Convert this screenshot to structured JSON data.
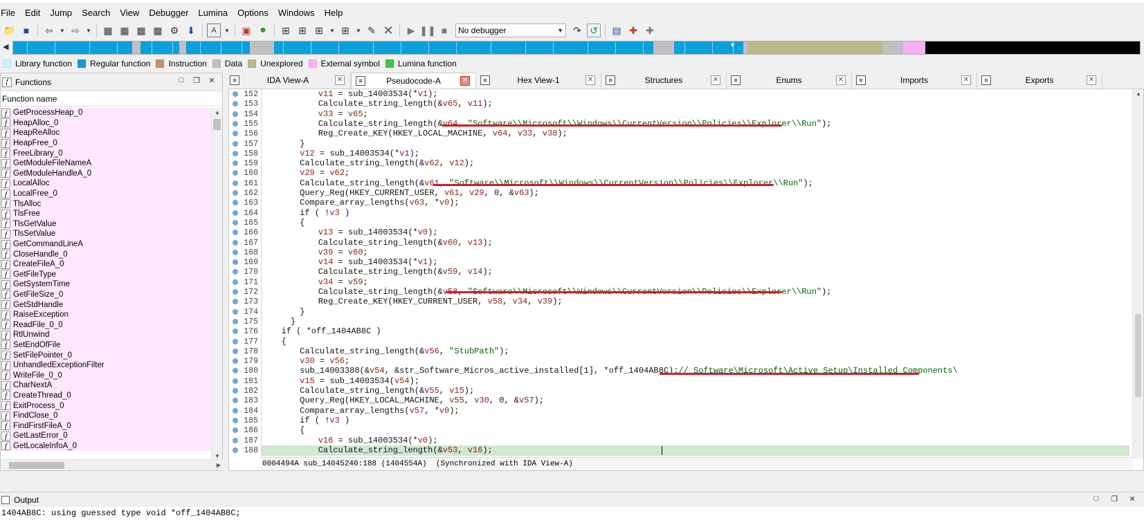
{
  "menu": [
    "File",
    "Edit",
    "Jump",
    "Search",
    "View",
    "Debugger",
    "Lumina",
    "Options",
    "Windows",
    "Help"
  ],
  "toolbar": {
    "debugger_select": "No debugger"
  },
  "legend": [
    {
      "label": "Library function",
      "color": "#c5f5fb"
    },
    {
      "label": "Regular function",
      "color": "#0aa0dc"
    },
    {
      "label": "Instruction",
      "color": "#c1916b"
    },
    {
      "label": "Data",
      "color": "#c0c0c0"
    },
    {
      "label": "Unexplored",
      "color": "#bdb78a"
    },
    {
      "label": "External symbol",
      "color": "#ffaef8"
    },
    {
      "label": "Lumina function",
      "color": "#3cc94a"
    }
  ],
  "functions_panel": {
    "title": "Functions",
    "column_header": "Function name",
    "icon_glyph": "f",
    "items": [
      "GetProcessHeap_0",
      "HeapAlloc_0",
      "HeapReAlloc",
      "HeapFree_0",
      "FreeLibrary_0",
      "GetModuleFileNameA",
      "GetModuleHandleA_0",
      "LocalAlloc",
      "LocalFree_0",
      "TlsAlloc",
      "TlsFree",
      "TlsGetValue",
      "TlsSetValue",
      "GetCommandLineA",
      "CloseHandle_0",
      "CreateFileA_0",
      "GetFileType",
      "GetSystemTime",
      "GetFileSize_0",
      "GetStdHandle",
      "RaiseException",
      "ReadFile_0_0",
      "RtlUnwind",
      "SetEndOfFile",
      "SetFilePointer_0",
      "UnhandledExceptionFilter",
      "WriteFile_0_0",
      "CharNextA",
      "CreateThread_0",
      "ExitProcess_0",
      "FindClose_0",
      "FindFirstFileA_0",
      "GetLastError_0",
      "GetLocaleInfoA_0"
    ]
  },
  "tabs": [
    {
      "label": "IDA View-A",
      "active": false
    },
    {
      "label": "Pseudocode-A",
      "active": true
    },
    {
      "label": "Hex View-1",
      "active": false
    },
    {
      "label": "Structures",
      "active": false
    },
    {
      "label": "Enums",
      "active": false
    },
    {
      "label": "Imports",
      "active": false
    },
    {
      "label": "Exports",
      "active": false
    }
  ],
  "code": [
    {
      "n": "152",
      "indent": 4,
      "segs": [
        [
          "v",
          "v11"
        ],
        [
          "",
          " = sub_14003534(*"
        ],
        [
          "v",
          "v1"
        ],
        [
          "",
          ");"
        ]
      ]
    },
    {
      "n": "153",
      "indent": 4,
      "segs": [
        [
          "",
          "Calculate_string_length(&"
        ],
        [
          "v",
          "v65"
        ],
        [
          "",
          ", "
        ],
        [
          "v",
          "v11"
        ],
        [
          "",
          ");"
        ]
      ]
    },
    {
      "n": "154",
      "indent": 4,
      "segs": [
        [
          "v",
          "v33"
        ],
        [
          "",
          " = "
        ],
        [
          "v",
          "v65"
        ],
        [
          "",
          ";"
        ]
      ]
    },
    {
      "n": "155",
      "indent": 4,
      "segs": [
        [
          "",
          "Calculate_string_length(&"
        ],
        [
          "v",
          "v64"
        ],
        [
          "",
          ", "
        ],
        [
          "s",
          "\"Software\\\\Microsoft\\\\Windows\\\\CurrentVersion\\\\Policies\\\\Explorer\\\\Run\""
        ],
        [
          "",
          ");"
        ]
      ]
    },
    {
      "n": "156",
      "indent": 4,
      "segs": [
        [
          "",
          "Reg_Create_KEY(HKEY_LOCAL_MACHINE, "
        ],
        [
          "v",
          "v64"
        ],
        [
          "",
          ", "
        ],
        [
          "v",
          "v33"
        ],
        [
          "",
          ", "
        ],
        [
          "v",
          "v38"
        ],
        [
          "",
          ");"
        ]
      ]
    },
    {
      "n": "157",
      "indent": 2,
      "segs": [
        [
          "",
          "}"
        ]
      ]
    },
    {
      "n": "158",
      "indent": 2,
      "segs": [
        [
          "v",
          "v12"
        ],
        [
          "",
          " = sub_14003534(*"
        ],
        [
          "v",
          "v1"
        ],
        [
          "",
          ");"
        ]
      ]
    },
    {
      "n": "159",
      "indent": 2,
      "segs": [
        [
          "",
          "Calculate_string_length(&"
        ],
        [
          "v",
          "v62"
        ],
        [
          "",
          ", "
        ],
        [
          "v",
          "v12"
        ],
        [
          "",
          ");"
        ]
      ]
    },
    {
      "n": "160",
      "indent": 2,
      "segs": [
        [
          "v",
          "v29"
        ],
        [
          "",
          " = "
        ],
        [
          "v",
          "v62"
        ],
        [
          "",
          ";"
        ]
      ]
    },
    {
      "n": "161",
      "indent": 2,
      "segs": [
        [
          "",
          "Calculate_string_length(&"
        ],
        [
          "v",
          "v61"
        ],
        [
          "",
          ", "
        ],
        [
          "s",
          "\"Software\\\\Microsoft\\\\Windows\\\\CurrentVersion\\\\Policies\\\\Explorer\\\\Run\""
        ],
        [
          "",
          ");"
        ]
      ]
    },
    {
      "n": "162",
      "indent": 2,
      "segs": [
        [
          "",
          "Query_Reg(HKEY_CURRENT_USER, "
        ],
        [
          "v",
          "v61"
        ],
        [
          "",
          ", "
        ],
        [
          "v",
          "v29"
        ],
        [
          "",
          ", 0, &"
        ],
        [
          "v",
          "v63"
        ],
        [
          "",
          ");"
        ]
      ]
    },
    {
      "n": "163",
      "indent": 2,
      "segs": [
        [
          "",
          "Compare_array_lengths("
        ],
        [
          "v",
          "v63"
        ],
        [
          "",
          ", *"
        ],
        [
          "v",
          "v0"
        ],
        [
          "",
          ");"
        ]
      ]
    },
    {
      "n": "164",
      "indent": 2,
      "segs": [
        [
          "",
          "if ( !"
        ],
        [
          "v",
          "v3"
        ],
        [
          "",
          " )"
        ]
      ]
    },
    {
      "n": "165",
      "indent": 2,
      "segs": [
        [
          "",
          "{"
        ]
      ]
    },
    {
      "n": "166",
      "indent": 4,
      "segs": [
        [
          "v",
          "v13"
        ],
        [
          "",
          " = sub_14003534(*"
        ],
        [
          "v",
          "v0"
        ],
        [
          "",
          ");"
        ]
      ]
    },
    {
      "n": "167",
      "indent": 4,
      "segs": [
        [
          "",
          "Calculate_string_length(&"
        ],
        [
          "v",
          "v60"
        ],
        [
          "",
          ", "
        ],
        [
          "v",
          "v13"
        ],
        [
          "",
          ");"
        ]
      ]
    },
    {
      "n": "168",
      "indent": 4,
      "segs": [
        [
          "v",
          "v39"
        ],
        [
          "",
          " = "
        ],
        [
          "v",
          "v60"
        ],
        [
          "",
          ";"
        ]
      ]
    },
    {
      "n": "169",
      "indent": 4,
      "segs": [
        [
          "v",
          "v14"
        ],
        [
          "",
          " = sub_14003534(*"
        ],
        [
          "v",
          "v1"
        ],
        [
          "",
          ");"
        ]
      ]
    },
    {
      "n": "170",
      "indent": 4,
      "segs": [
        [
          "",
          "Calculate_string_length(&"
        ],
        [
          "v",
          "v59"
        ],
        [
          "",
          ", "
        ],
        [
          "v",
          "v14"
        ],
        [
          "",
          ");"
        ]
      ]
    },
    {
      "n": "171",
      "indent": 4,
      "segs": [
        [
          "v",
          "v34"
        ],
        [
          "",
          " = "
        ],
        [
          "v",
          "v59"
        ],
        [
          "",
          ";"
        ]
      ]
    },
    {
      "n": "172",
      "indent": 4,
      "segs": [
        [
          "",
          "Calculate_string_length(&"
        ],
        [
          "v",
          "v58"
        ],
        [
          "",
          ", "
        ],
        [
          "s",
          "\"Software\\\\Microsoft\\\\Windows\\\\CurrentVersion\\\\Policies\\\\Explorer\\\\Run\""
        ],
        [
          "",
          ");"
        ]
      ]
    },
    {
      "n": "173",
      "indent": 4,
      "segs": [
        [
          "",
          "Reg_Create_KEY(HKEY_CURRENT_USER, "
        ],
        [
          "v",
          "v58"
        ],
        [
          "",
          ", "
        ],
        [
          "v",
          "v34"
        ],
        [
          "",
          ", "
        ],
        [
          "v",
          "v39"
        ],
        [
          "",
          ");"
        ]
      ]
    },
    {
      "n": "174",
      "indent": 2,
      "segs": [
        [
          "",
          "}"
        ]
      ]
    },
    {
      "n": "175",
      "indent": 1,
      "segs": [
        [
          "",
          "}"
        ]
      ]
    },
    {
      "n": "176",
      "indent": 0,
      "segs": [
        [
          "",
          "if ( *off_1404AB8C )"
        ]
      ]
    },
    {
      "n": "177",
      "indent": 0,
      "segs": [
        [
          "",
          "{"
        ]
      ]
    },
    {
      "n": "178",
      "indent": 2,
      "segs": [
        [
          "",
          "Calculate_string_length(&"
        ],
        [
          "v",
          "v56"
        ],
        [
          "",
          ", "
        ],
        [
          "s",
          "\"StubPath\""
        ],
        [
          "",
          ");"
        ]
      ]
    },
    {
      "n": "179",
      "indent": 2,
      "segs": [
        [
          "v",
          "v30"
        ],
        [
          "",
          " = "
        ],
        [
          "v",
          "v56"
        ],
        [
          "",
          ";"
        ]
      ]
    },
    {
      "n": "180",
      "indent": 2,
      "segs": [
        [
          "",
          "sub_14003388(&"
        ],
        [
          "v",
          "v54"
        ],
        [
          "",
          ", &str_Software_Micros_active_installed[1], *off_1404AB8C);"
        ],
        [
          "c",
          "// Software\\Microsoft\\Active Setup\\Installed Components\\"
        ]
      ]
    },
    {
      "n": "181",
      "indent": 2,
      "segs": [
        [
          "v",
          "v15"
        ],
        [
          "",
          " = sub_14003534("
        ],
        [
          "v",
          "v54"
        ],
        [
          "",
          ");"
        ]
      ]
    },
    {
      "n": "182",
      "indent": 2,
      "segs": [
        [
          "",
          "Calculate_string_length(&"
        ],
        [
          "v",
          "v55"
        ],
        [
          "",
          ", "
        ],
        [
          "v",
          "v15"
        ],
        [
          "",
          ");"
        ]
      ]
    },
    {
      "n": "183",
      "indent": 2,
      "segs": [
        [
          "",
          "Query_Reg(HKEY_LOCAL_MACHINE, "
        ],
        [
          "v",
          "v55"
        ],
        [
          "",
          ", "
        ],
        [
          "v",
          "v30"
        ],
        [
          "",
          ", 0, &"
        ],
        [
          "v",
          "v57"
        ],
        [
          "",
          ");"
        ]
      ]
    },
    {
      "n": "184",
      "indent": 2,
      "segs": [
        [
          "",
          "Compare_array_lengths("
        ],
        [
          "v",
          "v57"
        ],
        [
          "",
          ", *"
        ],
        [
          "v",
          "v0"
        ],
        [
          "",
          ");"
        ]
      ]
    },
    {
      "n": "185",
      "indent": 2,
      "segs": [
        [
          "",
          "if ( !"
        ],
        [
          "v",
          "v3"
        ],
        [
          "",
          " )"
        ]
      ]
    },
    {
      "n": "186",
      "indent": 2,
      "segs": [
        [
          "",
          "{"
        ]
      ]
    },
    {
      "n": "187",
      "indent": 4,
      "segs": [
        [
          "v",
          "v16"
        ],
        [
          "",
          " = sub_14003534(*"
        ],
        [
          "v",
          "v0"
        ],
        [
          "",
          ");"
        ]
      ]
    },
    {
      "n": "188",
      "indent": 4,
      "segs": [
        [
          "",
          "Calculate_string_length(&"
        ],
        [
          "v",
          "v53"
        ],
        [
          "",
          ", "
        ],
        [
          "v",
          "v16"
        ],
        [
          "",
          ");"
        ]
      ],
      "highlight": true
    }
  ],
  "status_line": "0004494A sub_14045240:188 (1404554A)  (Synchronized with IDA View-A)",
  "output_panel": {
    "title": "Output",
    "text": "1404AB8C: using guessed type void *off_1404AB8C;"
  },
  "colors": {
    "variable": "#8a1f11",
    "string": "#006400",
    "comment": "#006400",
    "highlight_line": "#cfe8cf",
    "annotation_underline": "#d01b2e",
    "function_row_bg": "#ffe8ff",
    "active_tab_close": "#e9897d"
  }
}
